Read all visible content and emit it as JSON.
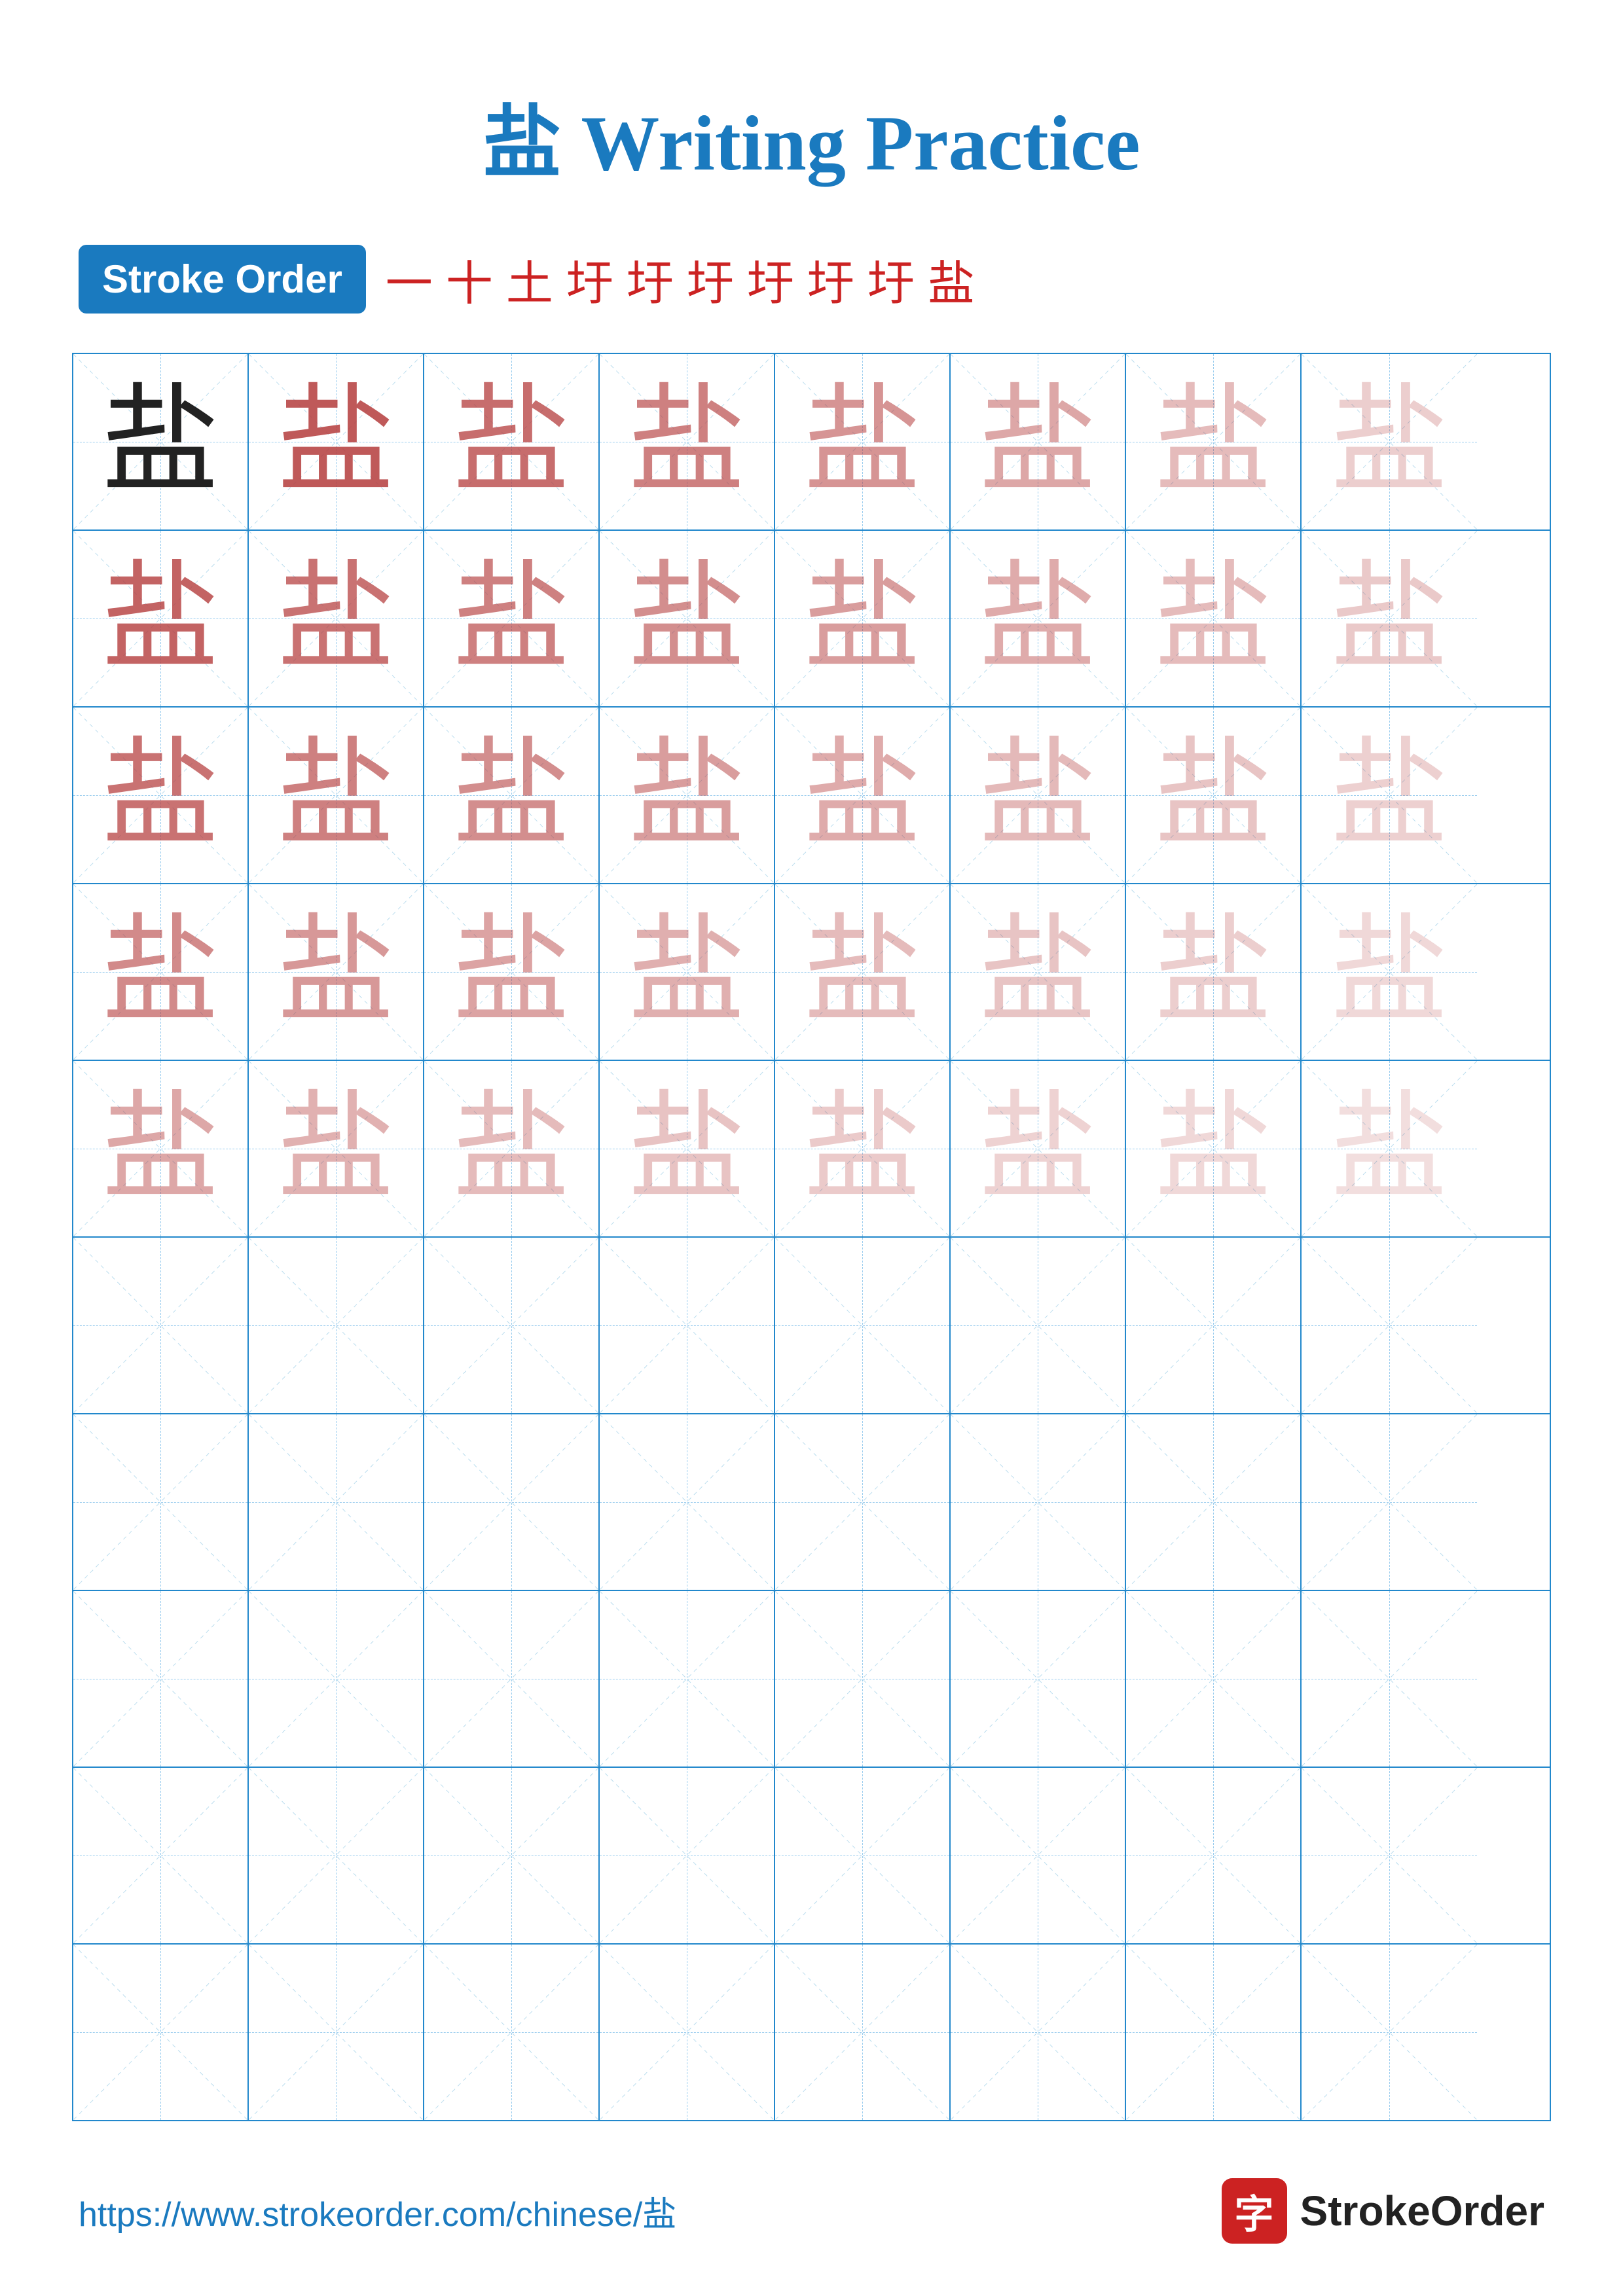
{
  "title": "盐 Writing Practice",
  "character": "盐",
  "stroke_order_label": "Stroke Order",
  "stroke_order_chars": [
    "一",
    "十",
    "土",
    "圩",
    "圩",
    "圩",
    "圩",
    "圩",
    "圩",
    "盐"
  ],
  "rows": 10,
  "cols": 8,
  "footer_url": "https://www.strokeorder.com/chinese/盐",
  "footer_brand": "StrokeOrder",
  "brand_char": "字"
}
